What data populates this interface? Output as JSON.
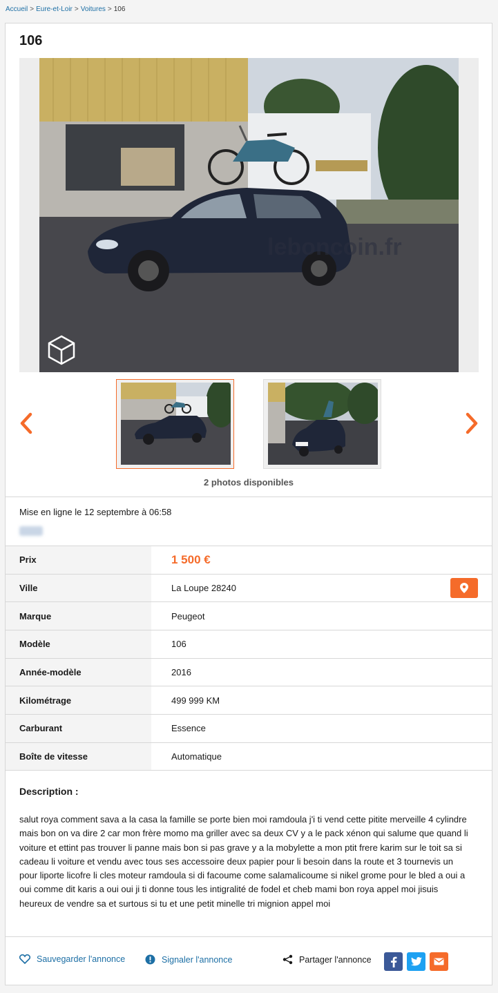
{
  "breadcrumb": {
    "home": "Accueil",
    "region": "Eure-et-Loir",
    "category": "Voitures",
    "current": "106",
    "separator": ">"
  },
  "listing": {
    "title": "106",
    "photo_count_label": "2 photos disponibles",
    "posted_label": "Mise en ligne le 12 septembre à 06:58",
    "watermark": "leboncoin.fr"
  },
  "attributes": {
    "price": {
      "label": "Prix",
      "value": "1 500 €"
    },
    "city": {
      "label": "Ville",
      "value": "La Loupe 28240"
    },
    "brand": {
      "label": "Marque",
      "value": "Peugeot"
    },
    "model": {
      "label": "Modèle",
      "value": "106"
    },
    "year": {
      "label": "Année-modèle",
      "value": "2016"
    },
    "mileage": {
      "label": "Kilométrage",
      "value": "499 999 KM"
    },
    "fuel": {
      "label": "Carburant",
      "value": "Essence"
    },
    "gearbox": {
      "label": "Boîte de vitesse",
      "value": "Automatique"
    }
  },
  "description": {
    "title": "Description :",
    "text": "salut roya comment sava a la casa la famille se porte bien moi ramdoula j'i ti vend cette pitite merveille 4 cylindre mais bon on va dire 2 car mon frère momo ma griller avec sa deux CV y a le pack xénon qui salume que quand li voiture et ettint pas trouver li panne mais bon si pas grave y a la mobylette a mon ptit frere karim sur le toit sa si cadeau li voiture et vendu avec tous ses accessoire deux papier pour li besoin dans la route et 3 tournevis un pour liporte licofre li cles moteur ramdoula si di facoume come salamalicoume si nikel grome pour le bled a oui a oui comme dit karis a oui oui ji ti donne tous les intigralité de fodel et cheb mami bon roya appel moi jisuis heureux de vendre sa et surtous si tu et une petit minelle tri mignion appel moi"
  },
  "actions": {
    "save": "Sauvegarder l'annonce",
    "report": "Signaler l'annonce",
    "share": "Partager l'annonce"
  },
  "colors": {
    "accent": "#f56b2a",
    "link": "#1d6fa5",
    "facebook": "#3b5998",
    "twitter": "#1da1f2",
    "email": "#f56b2a"
  },
  "icons": [
    "chevron-left-icon",
    "chevron-right-icon",
    "location-pin-icon",
    "heart-icon",
    "alert-icon",
    "share-icon",
    "facebook-icon",
    "twitter-icon",
    "email-icon",
    "lbc-logo-icon"
  ]
}
